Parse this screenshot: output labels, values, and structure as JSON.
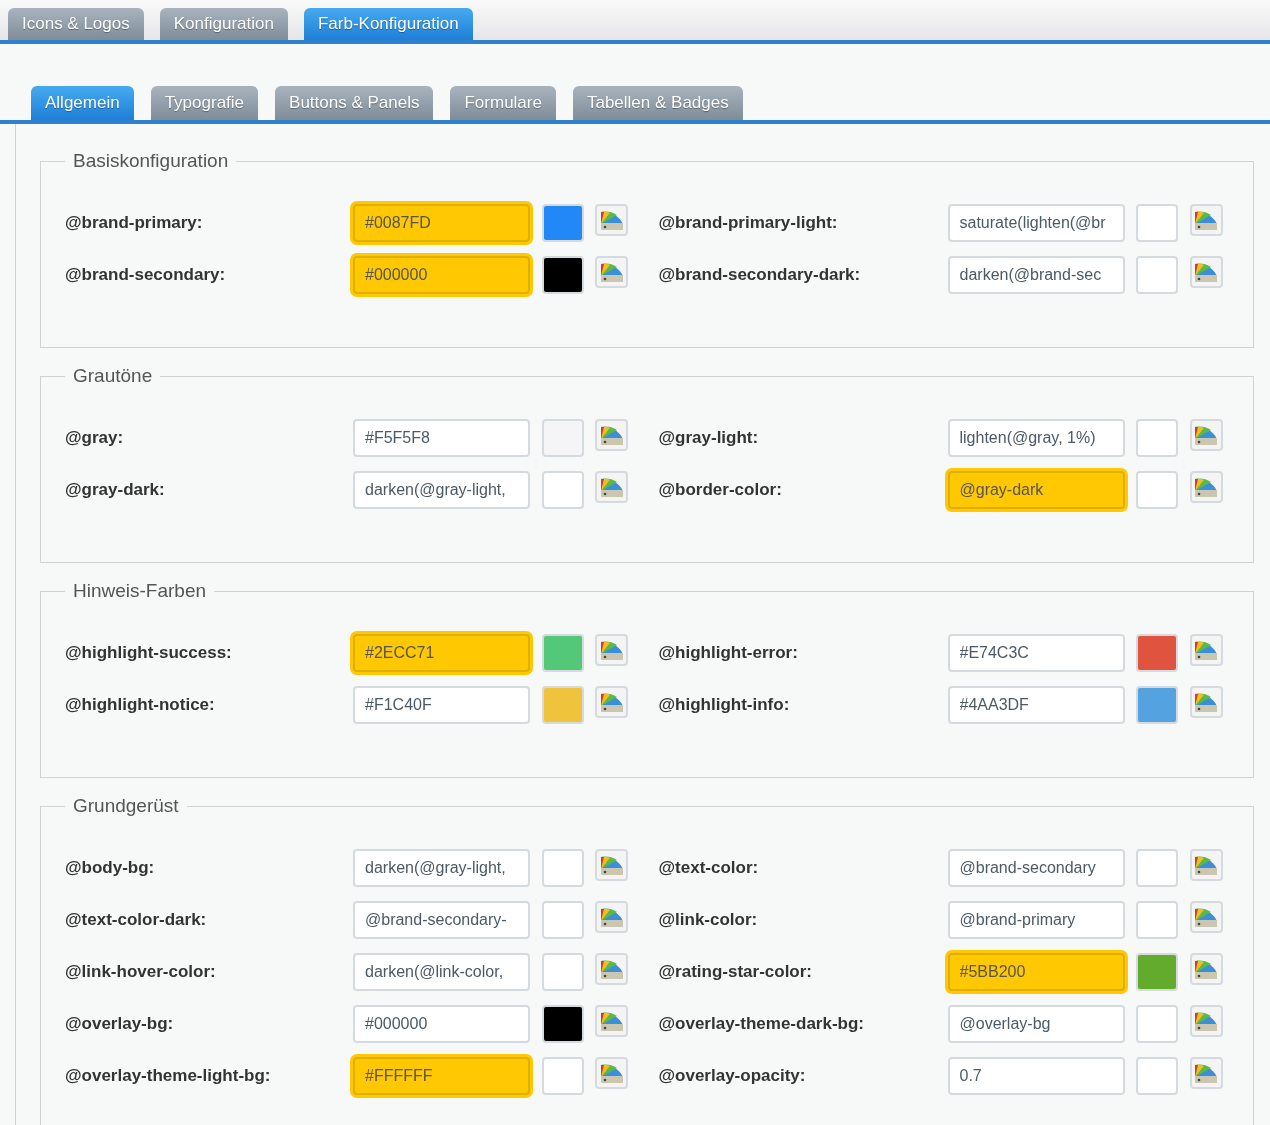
{
  "main_tabs": [
    {
      "label": "Icons & Logos",
      "selected": false
    },
    {
      "label": "Konfiguration",
      "selected": false
    },
    {
      "label": "Farb-Konfiguration",
      "selected": true
    }
  ],
  "sub_tabs": [
    {
      "label": "Allgemein",
      "selected": true
    },
    {
      "label": "Typografie",
      "selected": false
    },
    {
      "label": "Buttons & Panels",
      "selected": false
    },
    {
      "label": "Formulare",
      "selected": false
    },
    {
      "label": "Tabellen & Badges",
      "selected": false
    }
  ],
  "sections": [
    {
      "title": "Basiskonfiguration",
      "fields": [
        {
          "label": "@brand-primary:",
          "value": "#0087FD",
          "highlighted": true,
          "color": "#2288f8"
        },
        {
          "label": "@brand-primary-light:",
          "value": "saturate(lighten(@br",
          "highlighted": false
        },
        {
          "label": "@brand-secondary:",
          "value": "#000000",
          "highlighted": true,
          "color": "#000000"
        },
        {
          "label": "@brand-secondary-dark:",
          "value": "darken(@brand-sec",
          "highlighted": false
        }
      ]
    },
    {
      "title": "Grautöne",
      "fields": [
        {
          "label": "@gray:",
          "value": "#F5F5F8",
          "highlighted": false,
          "color": "#f5f5f8"
        },
        {
          "label": "@gray-light:",
          "value": "lighten(@gray, 1%)",
          "highlighted": false
        },
        {
          "label": "@gray-dark:",
          "value": "darken(@gray-light,",
          "highlighted": false
        },
        {
          "label": "@border-color:",
          "value": "@gray-dark",
          "highlighted": true
        }
      ]
    },
    {
      "title": "Hinweis-Farben",
      "fields": [
        {
          "label": "@highlight-success:",
          "value": "#2ECC71",
          "highlighted": true,
          "color": "#52c878"
        },
        {
          "label": "@highlight-error:",
          "value": "#E74C3C",
          "highlighted": false,
          "color": "#e0533f"
        },
        {
          "label": "@highlight-notice:",
          "value": "#F1C40F",
          "highlighted": false,
          "color": "#f0c33c"
        },
        {
          "label": "@highlight-info:",
          "value": "#4AA3DF",
          "highlighted": false,
          "color": "#54a2e0"
        }
      ]
    },
    {
      "title": "Grundgerüst",
      "fields": [
        {
          "label": "@body-bg:",
          "value": "darken(@gray-light,",
          "highlighted": false
        },
        {
          "label": "@text-color:",
          "value": "@brand-secondary",
          "highlighted": false
        },
        {
          "label": "@text-color-dark:",
          "value": "@brand-secondary-",
          "highlighted": false
        },
        {
          "label": "@link-color:",
          "value": "@brand-primary",
          "highlighted": false
        },
        {
          "label": "@link-hover-color:",
          "value": "darken(@link-color,",
          "highlighted": false
        },
        {
          "label": "@rating-star-color:",
          "value": "#5BB200",
          "highlighted": true,
          "color": "#63ab2c"
        },
        {
          "label": "@overlay-bg:",
          "value": "#000000",
          "highlighted": false,
          "color": "#000000"
        },
        {
          "label": "@overlay-theme-dark-bg:",
          "value": "@overlay-bg",
          "highlighted": false
        },
        {
          "label": "@overlay-theme-light-bg:",
          "value": "#FFFFFF",
          "highlighted": true,
          "color": "#ffffff"
        },
        {
          "label": "@overlay-opacity:",
          "value": "0.7",
          "highlighted": false
        }
      ]
    }
  ]
}
